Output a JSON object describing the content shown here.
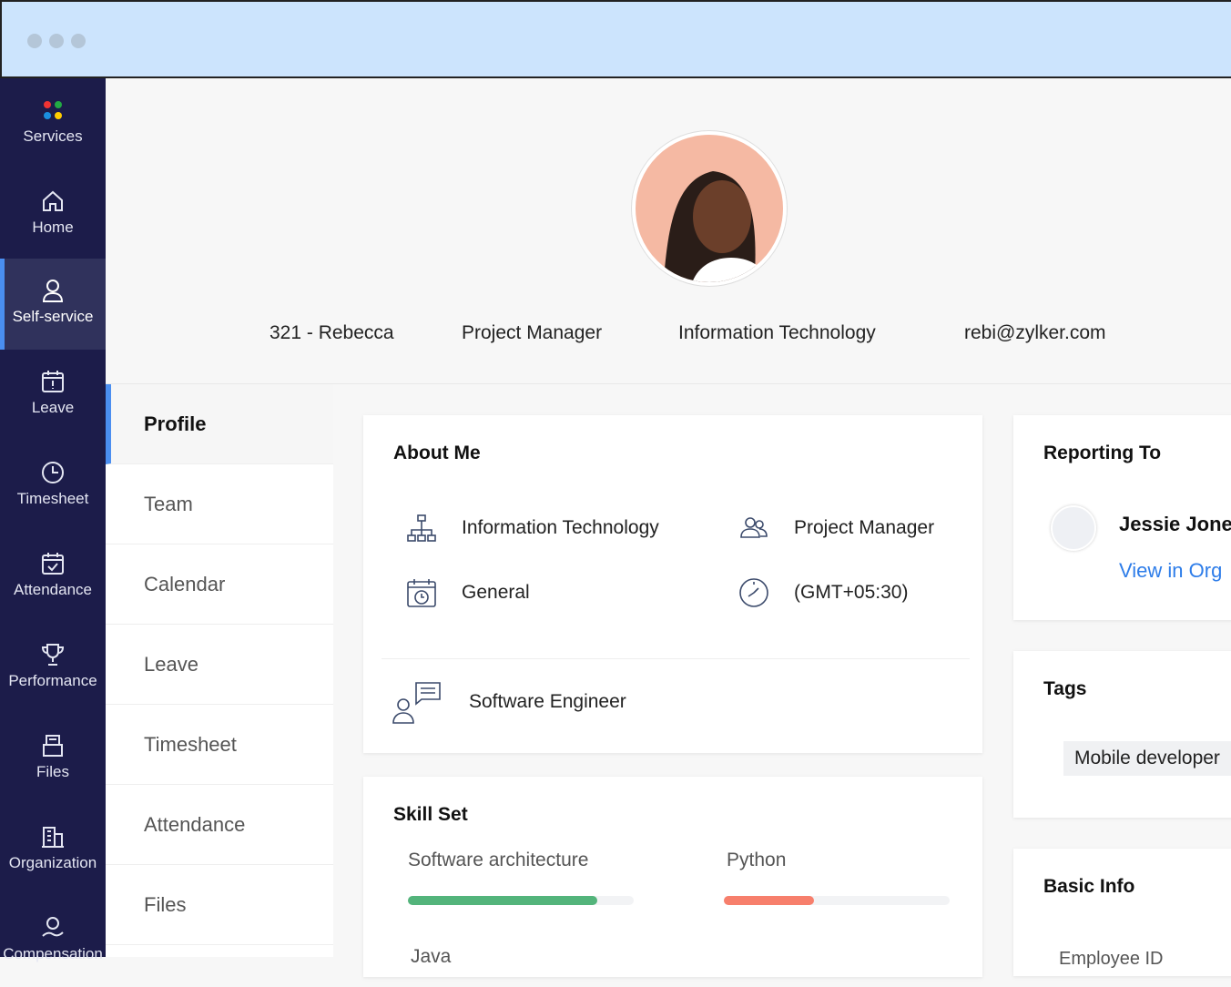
{
  "sidebar": {
    "items": [
      {
        "label": "Services"
      },
      {
        "label": "Home"
      },
      {
        "label": "Self-service"
      },
      {
        "label": "Leave"
      },
      {
        "label": "Timesheet"
      },
      {
        "label": "Attendance"
      },
      {
        "label": "Performance"
      },
      {
        "label": "Files"
      },
      {
        "label": "Organization"
      },
      {
        "label": "Compensation"
      }
    ]
  },
  "header": {
    "id_name": "321 - Rebecca",
    "role": "Project Manager",
    "department": "Information Technology",
    "email": "rebi@zylker.com"
  },
  "subnav": {
    "items": [
      "Profile",
      "Team",
      "Calendar",
      "Leave",
      "Timesheet",
      "Attendance",
      "Files"
    ]
  },
  "about": {
    "title": "About Me",
    "department": "Information Technology",
    "role": "Project Manager",
    "location": "General",
    "timezone": "(GMT+05:30)",
    "designation": "Software Engineer"
  },
  "skills": {
    "title": "Skill Set",
    "items": [
      {
        "name": "Software architecture",
        "level": 0.84,
        "color": "#53b47b"
      },
      {
        "name": "Python",
        "level": 0.4,
        "color": "#f77f6c"
      }
    ],
    "next": "Java"
  },
  "reporting": {
    "title": "Reporting To",
    "name": "Jessie Jones",
    "link": "View in Org"
  },
  "tags": {
    "title": "Tags",
    "items": [
      "Mobile developer"
    ]
  },
  "basic": {
    "title": "Basic Info",
    "field": "Employee ID"
  }
}
